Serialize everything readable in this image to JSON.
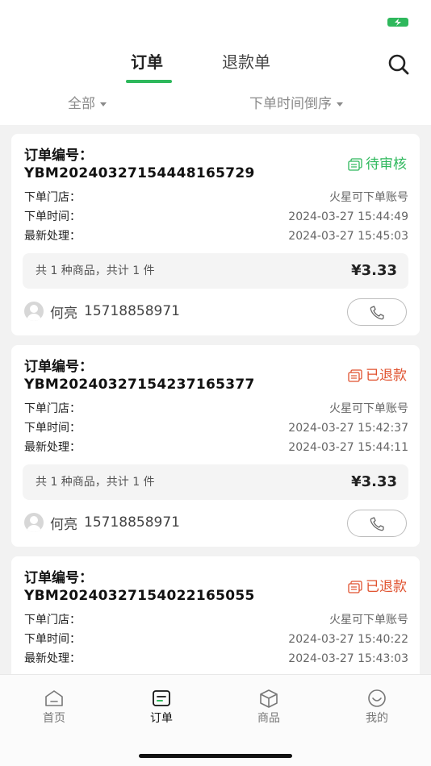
{
  "status_bar": {
    "battery_icon": "battery-charging-icon",
    "battery_color": "#2eb85c"
  },
  "tabs": [
    {
      "label": "订单",
      "active": true
    },
    {
      "label": "退款单",
      "active": false
    }
  ],
  "search_icon": "search-icon",
  "filters": {
    "scope": "全部",
    "sort": "下单时间倒序"
  },
  "labels": {
    "order_no": "订单编号：",
    "store": "下单门店：",
    "order_time": "下单时间：",
    "last_processed": "最新处理："
  },
  "colors": {
    "accent": "#2eb85c",
    "pending": "#2eb85c",
    "refunded": "#e0522f"
  },
  "orders": [
    {
      "order_no": "YBM20240327154448165729",
      "status": "待审核",
      "status_type": "pending",
      "store": "火星可下单账号",
      "order_time": "2024-03-27 15:44:49",
      "last_processed": "2024-03-27 15:45:03",
      "summary": "共 1 种商品，共计 1 件",
      "price": "¥3.33",
      "contact_name": "何亮",
      "contact_phone": "15718858971"
    },
    {
      "order_no": "YBM20240327154237165377",
      "status": "已退款",
      "status_type": "refunded",
      "store": "火星可下单账号",
      "order_time": "2024-03-27 15:42:37",
      "last_processed": "2024-03-27 15:44:11",
      "summary": "共 1 种商品，共计 1 件",
      "price": "¥3.33",
      "contact_name": "何亮",
      "contact_phone": "15718858971"
    },
    {
      "order_no": "YBM20240327154022165055",
      "status": "已退款",
      "status_type": "refunded",
      "store": "火星可下单账号",
      "order_time": "2024-03-27 15:40:22",
      "last_processed": "2024-03-27 15:43:03"
    }
  ],
  "bottom_nav": [
    {
      "label": "首页",
      "icon": "home-icon",
      "active": false
    },
    {
      "label": "订单",
      "icon": "orders-icon",
      "active": true
    },
    {
      "label": "商品",
      "icon": "box-icon",
      "active": false
    },
    {
      "label": "我的",
      "icon": "smile-icon",
      "active": false
    }
  ]
}
